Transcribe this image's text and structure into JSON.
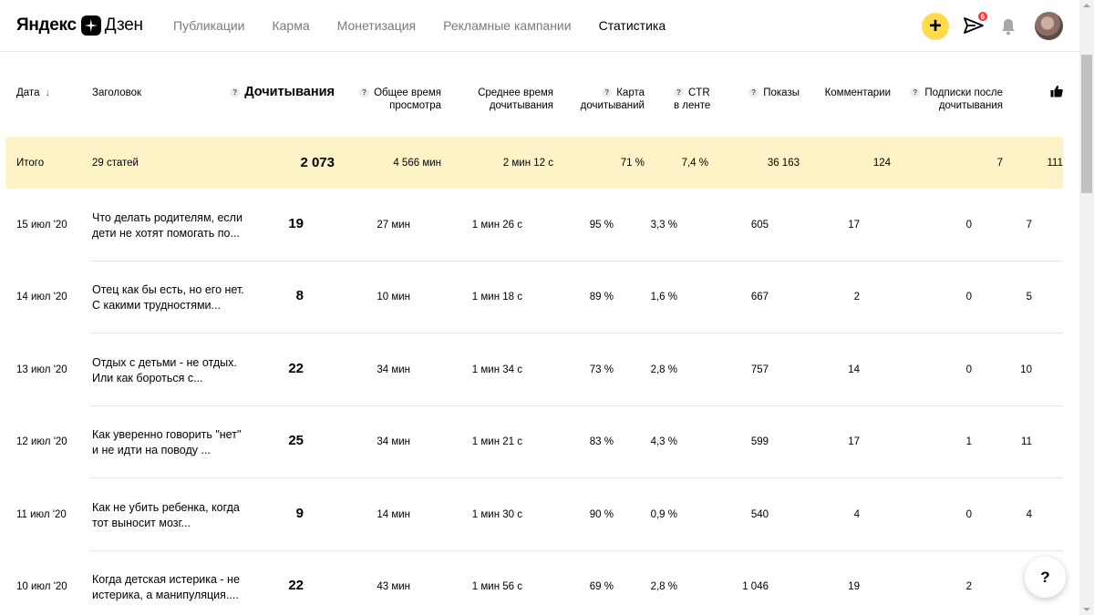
{
  "logo": {
    "yandex": "Яндекс",
    "dzen": "Дзен"
  },
  "nav": {
    "items": [
      {
        "label": "Публикации"
      },
      {
        "label": "Карма"
      },
      {
        "label": "Монетизация"
      },
      {
        "label": "Рекламные кампании"
      },
      {
        "label": "Статистика",
        "active": true
      }
    ]
  },
  "header_actions": {
    "add_label": "+",
    "messages_badge": "6",
    "accent_color": "#ffdb4d"
  },
  "table": {
    "columns": {
      "date": "Дата",
      "title": "Заголовок",
      "reads": "Дочитывания",
      "total_time_1": "Общее время",
      "total_time_2": "просмотра",
      "avg_time_1": "Среднее время",
      "avg_time_2": "дочитывания",
      "read_map_1": "Карта",
      "read_map_2": "дочитываний",
      "ctr_1": "CTR",
      "ctr_2": "в ленте",
      "impressions": "Показы",
      "comments": "Комментарии",
      "subs_1": "Подписки после",
      "subs_2": "дочитывания",
      "help_mark": "?",
      "sort_arrow": "↓",
      "likes_icon": "thumbs-up-icon"
    },
    "total": {
      "label": "Итого",
      "title": "29 статей",
      "reads": "2 073",
      "total_time": "4 566 мин",
      "avg_time": "2 мин 12 с",
      "read_map": "71 %",
      "ctr": "7,4 %",
      "impressions": "36 163",
      "comments": "124",
      "subs": "7",
      "likes": "111"
    },
    "rows": [
      {
        "date": "15 июл '20",
        "title": "Что делать родителям, если дети не хотят помогать по...",
        "reads": "19",
        "total_time": "27 мин",
        "avg_time": "1 мин 26 с",
        "read_map": "95 %",
        "ctr": "3,3 %",
        "impressions": "605",
        "comments": "17",
        "subs": "0",
        "likes": "7"
      },
      {
        "date": "14 июл '20",
        "title": "Отец как бы есть, но его нет. С какими трудностями...",
        "reads": "8",
        "total_time": "10 мин",
        "avg_time": "1 мин 18 с",
        "read_map": "89 %",
        "ctr": "1,6 %",
        "impressions": "667",
        "comments": "2",
        "subs": "0",
        "likes": "5"
      },
      {
        "date": "13 июл '20",
        "title": "Отдых с детьми - не отдых. Или как бороться с...",
        "reads": "22",
        "total_time": "34 мин",
        "avg_time": "1 мин 34 с",
        "read_map": "73 %",
        "ctr": "2,8 %",
        "impressions": "757",
        "comments": "14",
        "subs": "0",
        "likes": "10"
      },
      {
        "date": "12 июл '20",
        "title": "Как уверенно говорить \"нет\" и не идти на поводу ...",
        "reads": "25",
        "total_time": "34 мин",
        "avg_time": "1 мин 21 с",
        "read_map": "83 %",
        "ctr": "4,3 %",
        "impressions": "599",
        "comments": "17",
        "subs": "1",
        "likes": "11"
      },
      {
        "date": "11 июл '20",
        "title": "Как не убить ребенка, когда тот выносит мозг...",
        "reads": "9",
        "total_time": "14 мин",
        "avg_time": "1 мин 30 с",
        "read_map": "90 %",
        "ctr": "0,9 %",
        "impressions": "540",
        "comments": "4",
        "subs": "0",
        "likes": "4"
      },
      {
        "date": "10 июл '20",
        "title": "Когда детская истерика - не истерика, а манипуляция....",
        "reads": "22",
        "total_time": "43 мин",
        "avg_time": "1 мин 56 с",
        "read_map": "69 %",
        "ctr": "2,8 %",
        "impressions": "1 046",
        "comments": "19",
        "subs": "2",
        "likes": ""
      }
    ]
  },
  "help_button": "?"
}
